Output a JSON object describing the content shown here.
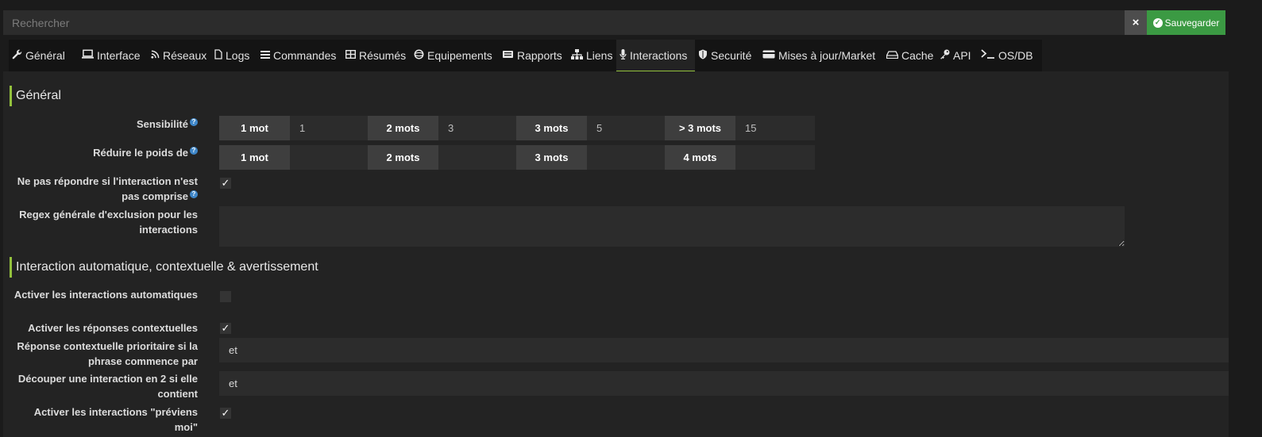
{
  "search": {
    "placeholder": "Rechercher"
  },
  "toolbar": {
    "clear_icon": "×",
    "save_label": "Sauvegarder"
  },
  "tabs": [
    {
      "label": "Général",
      "icon": "wrench-icon"
    },
    {
      "label": "Interface",
      "icon": "laptop-icon"
    },
    {
      "label": "Réseaux",
      "icon": "rss-icon"
    },
    {
      "label": "Logs",
      "icon": "file-icon"
    },
    {
      "label": "Commandes",
      "icon": "list-icon"
    },
    {
      "label": "Résumés",
      "icon": "table-icon"
    },
    {
      "label": "Equipements",
      "icon": "cube-icon"
    },
    {
      "label": "Rapports",
      "icon": "newspaper-icon"
    },
    {
      "label": "Liens",
      "icon": "sitemap-icon"
    },
    {
      "label": "Interactions",
      "icon": "microphone-icon",
      "active": true
    },
    {
      "label": "Securité",
      "icon": "shield-icon"
    },
    {
      "label": "Mises à jour/Market",
      "icon": "credit-card-icon"
    },
    {
      "label": "Cache",
      "icon": "hdd-icon"
    },
    {
      "label": "API",
      "icon": "key-icon"
    },
    {
      "label": "OS/DB",
      "icon": "terminal-icon"
    }
  ],
  "sections": {
    "general": "Général",
    "auto": "Interaction automatique, contextuelle & avertissement"
  },
  "fields": {
    "sensibilite": {
      "label": "Sensibilité",
      "cells": [
        {
          "label": "1 mot",
          "value": "1"
        },
        {
          "label": "2 mots",
          "value": "3"
        },
        {
          "label": "3 mots",
          "value": "5"
        },
        {
          "label": "> 3 mots",
          "value": "15"
        }
      ]
    },
    "reduire": {
      "label": "Réduire le poids de",
      "cells": [
        {
          "label": "1 mot",
          "value": ""
        },
        {
          "label": "2 mots",
          "value": ""
        },
        {
          "label": "3 mots",
          "value": ""
        },
        {
          "label": "4 mots",
          "value": ""
        }
      ]
    },
    "ne_pas_repondre": {
      "label": "Ne pas répondre si l'interaction n'est pas comprise",
      "checked": true
    },
    "regex": {
      "label": "Regex générale d'exclusion pour les interactions",
      "value": ""
    },
    "activer_auto": {
      "label": "Activer les interactions automatiques",
      "checked": false
    },
    "activer_contexte": {
      "label": "Activer les réponses contextuelles",
      "checked": true
    },
    "reponse_prioritaire": {
      "label": "Réponse contextuelle prioritaire si la phrase commence par",
      "value": "et"
    },
    "decouper": {
      "label": "Découper une interaction en 2 si elle contient",
      "value": "et"
    },
    "previens_moi": {
      "label": "Activer les interactions \"préviens moi\"",
      "checked": true
    }
  },
  "colors": {
    "accent": "#93c13d",
    "save": "#3b9a43",
    "help": "#3f87c9"
  }
}
